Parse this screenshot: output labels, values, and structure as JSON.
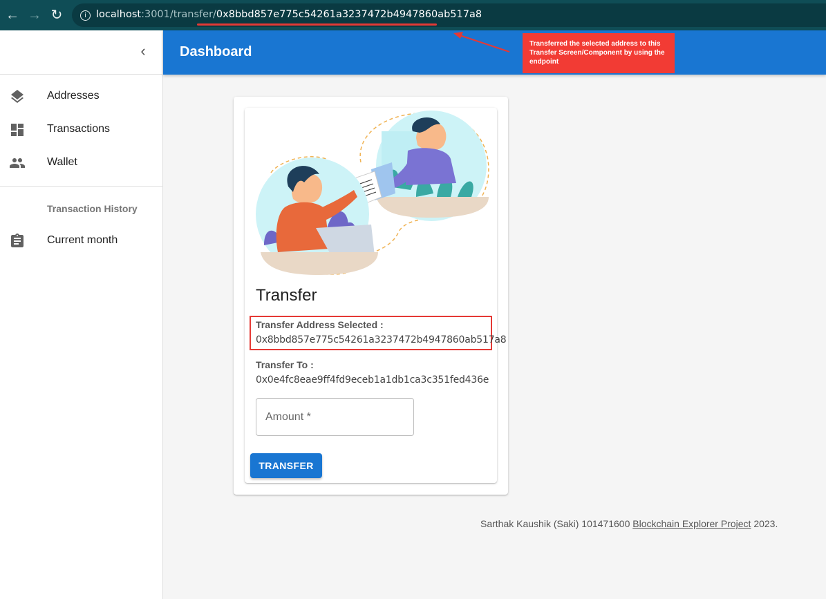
{
  "browser": {
    "back_icon": "arrow-left-icon",
    "forward_icon": "arrow-right-icon",
    "reload_icon": "reload-icon",
    "url_host": "localhost",
    "url_rest": ":3001/transfer/",
    "url_address": "0x8bbd857e775c54261a3237472b4947860ab517a8"
  },
  "annotation": {
    "text": "Transferred the selected address to this Transfer Screen/Component by using the endpoint",
    "color": "#f23b34"
  },
  "header": {
    "title": "Dashboard",
    "color": "#1976d2"
  },
  "sidebar": {
    "collapse_icon": "chevron-left-icon",
    "items": [
      {
        "label": "Addresses",
        "icon": "layers-icon"
      },
      {
        "label": "Transactions",
        "icon": "dashboard-icon"
      },
      {
        "label": "Wallet",
        "icon": "people-icon"
      }
    ],
    "subheader": "Transaction History",
    "history_items": [
      {
        "label": "Current month",
        "icon": "assignment-icon"
      }
    ]
  },
  "card": {
    "title": "Transfer",
    "selected_label": "Transfer Address Selected :",
    "selected_value": "0x8bbd857e775c54261a3237472b4947860ab517a8",
    "to_label": "Transfer To :",
    "to_value": "0x0e4fc8eae9ff4fd9eceb1a1db1ca3c351fed436e",
    "amount_placeholder": "Amount *",
    "button_label": "TRANSFER"
  },
  "footer": {
    "prefix": "Sarthak Kaushik (Saki) 101471600 ",
    "link": "Blockchain Explorer Project",
    "suffix": " 2023."
  }
}
